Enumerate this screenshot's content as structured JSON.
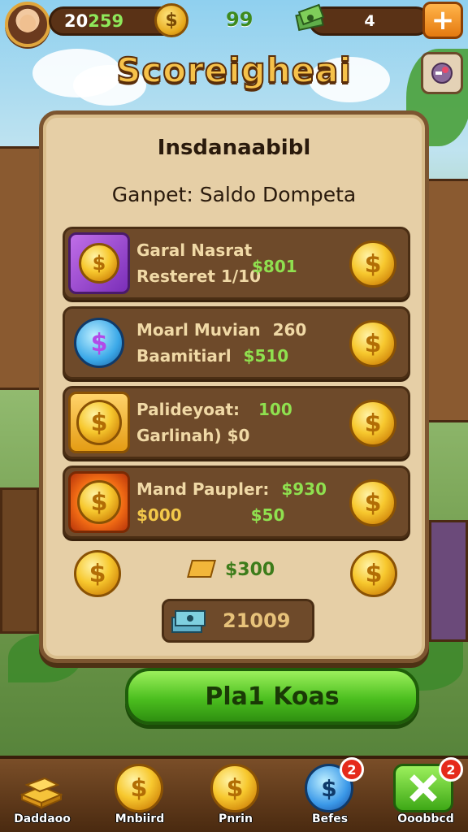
{
  "topbar": {
    "score_prefix": "20",
    "score_suffix": "259",
    "middle_value": "99",
    "cash_value": "4",
    "plus_label": "+"
  },
  "title": "Scoreigheai",
  "panel": {
    "title": "Insdanaabibl",
    "subtitle": "Ganpet: Saldo Dompeta",
    "rows": [
      {
        "line1": "Garal Nasrat",
        "line2": "Resteret 1/10",
        "amount": "$801",
        "icon": "purple-gem-coin-icon"
      },
      {
        "line1": "Moarl Muvian",
        "line1_value": "260",
        "line2": "Baamitiarl",
        "line2_value": "$510",
        "icon": "blue-dollar-coin-icon"
      },
      {
        "line1": "Palideyoat:",
        "line1_value": "100",
        "line2": "Garlinah) $0",
        "icon": "gold-coin-icon"
      },
      {
        "line1": "Mand Paupler:",
        "line1_value": "$930",
        "line2": "$000",
        "line2_value": "$50",
        "icon": "fire-coin-icon"
      }
    ],
    "bonus_amount": "$300",
    "total": "21009"
  },
  "play_button": "Pla1 Koas",
  "nav": [
    {
      "label": "Daddaoo",
      "icon": "gold-bars-icon"
    },
    {
      "label": "Mnbiird",
      "icon": "dollar-coin-icon"
    },
    {
      "label": "Pnrin",
      "icon": "dollar-coin-icon"
    },
    {
      "label": "Befes",
      "icon": "blue-coin-icon",
      "badge": "2"
    },
    {
      "label": "Ooobbcd",
      "icon": "cross-arrows-icon",
      "badge": "2"
    }
  ],
  "colors": {
    "panel_bg": "#e6cfa6",
    "row_bg": "#6e4a2a",
    "accent_green": "#4cbf1f",
    "gold": "#f7c82e",
    "title_gold": "#f6c24a"
  }
}
